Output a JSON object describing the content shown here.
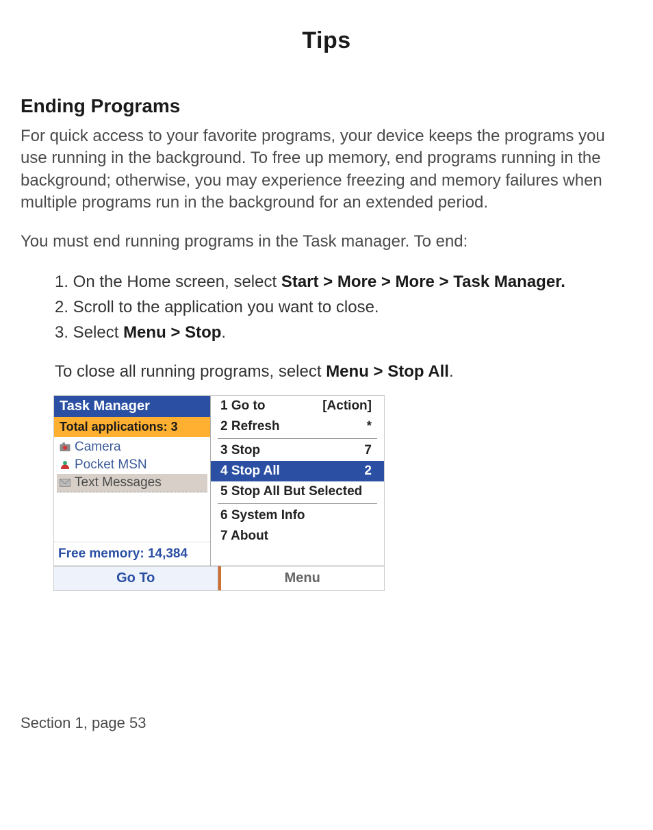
{
  "title": "Tips",
  "section_heading": "Ending Programs",
  "para1": "For quick access to your favorite programs, your device keeps the programs you use running in the background. To free up memory, end programs running in the background; otherwise, you may experience freezing and memory failures when multiple programs run in the background for an extended period.",
  "para2": "You must end running programs in the Task manager. To end:",
  "steps": {
    "s1_prefix": "1. On the Home screen, select ",
    "s1_bold": "Start > More > More > Task Manager.",
    "s2": "2. Scroll to the application you want to close.",
    "s3_prefix": "3. Select ",
    "s3_bold": "Menu > Stop",
    "s3_suffix": "."
  },
  "after_list_prefix": "To close all running programs, select ",
  "after_list_bold": "Menu > Stop All",
  "after_list_suffix": ".",
  "screenshot": {
    "title": "Task Manager",
    "subtitle": "Total applications: 3",
    "apps": {
      "a1": "Camera",
      "a2": "Pocket MSN",
      "a3": "Text Messages"
    },
    "free_memory": "Free memory: 14,384",
    "menu": {
      "m1_label": "1 Go to",
      "m1_key": "[Action]",
      "m2_label": "2 Refresh",
      "m2_key": "*",
      "m3_label": "3 Stop",
      "m3_key": "7",
      "m4_label": "4 Stop All",
      "m4_key": "2",
      "m5_label": "5 Stop All But Selected",
      "m6_label": "6 System Info",
      "m7_label": "7 About"
    },
    "softkey_left": "Go To",
    "softkey_right": "Menu"
  },
  "footer": "Section 1, page 53"
}
